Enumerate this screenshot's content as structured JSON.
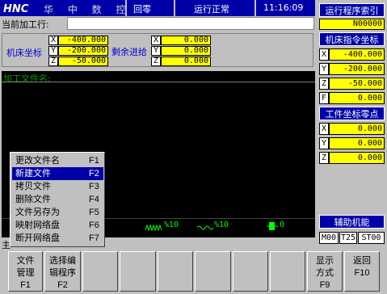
{
  "header": {
    "brand": "华 中 数 控",
    "mode": "回零",
    "state": "运行正常",
    "time": "11:16:09"
  },
  "current_job": {
    "label": "当前加工行:",
    "value": ""
  },
  "coords": {
    "label": "机床坐标",
    "remaining_label": "剩余进给",
    "machine": [
      {
        "axis": "X",
        "value": "-400.000"
      },
      {
        "axis": "Y",
        "value": "-200.000"
      },
      {
        "axis": "Z",
        "value": "-50.000"
      }
    ],
    "remaining": [
      {
        "axis": "X",
        "value": "0.000"
      },
      {
        "axis": "Y",
        "value": "0.000"
      },
      {
        "axis": "Z",
        "value": "0.000"
      }
    ]
  },
  "file_area": {
    "label": "加工文件名:"
  },
  "status_bar": {
    "feed": "%10",
    "spindle": "%10",
    "rapid": "0"
  },
  "popup_menu": [
    {
      "label": "更改文件名",
      "key": "F1"
    },
    {
      "label": "新建文件",
      "key": "F2"
    },
    {
      "label": "拷贝文件",
      "key": "F3"
    },
    {
      "label": "删除文件",
      "key": "F4"
    },
    {
      "label": "文件另存为",
      "key": "F5"
    },
    {
      "label": "映射网络盘",
      "key": "F6"
    },
    {
      "label": "断开网络盘",
      "key": "F7"
    }
  ],
  "main_label": "主",
  "right_panel": {
    "program_index_title": "运行程序索引",
    "program_index_value": "N00000",
    "cmd_title": "机床指令坐标",
    "cmd": [
      {
        "axis": "X",
        "value": "-400.000"
      },
      {
        "axis": "Y",
        "value": "-200.000"
      },
      {
        "axis": "Z",
        "value": "-50.000"
      },
      {
        "axis": "F",
        "value": "0.000"
      }
    ],
    "wcs_title": "工件坐标零点",
    "wcs": [
      {
        "axis": "X",
        "value": "0.000"
      },
      {
        "axis": "Y",
        "value": "0.000"
      },
      {
        "axis": "Z",
        "value": "0.000"
      }
    ],
    "aux_title": "辅助机能",
    "aux": [
      "M00",
      "T25",
      "ST00"
    ]
  },
  "fkeys": [
    {
      "line1": "文件",
      "line2": "管理",
      "key": "F1"
    },
    {
      "line1": "选择编",
      "line2": "辑程序",
      "key": "F2"
    },
    {
      "line1": "",
      "line2": "",
      "key": ""
    },
    {
      "line1": "",
      "line2": "",
      "key": ""
    },
    {
      "line1": "",
      "line2": "",
      "key": ""
    },
    {
      "line1": "",
      "line2": "",
      "key": ""
    },
    {
      "line1": "",
      "line2": "",
      "key": ""
    },
    {
      "line1": "",
      "line2": "",
      "key": ""
    },
    {
      "line1": "显示",
      "line2": "方式",
      "key": "F9"
    },
    {
      "line1": "返回",
      "line2": "",
      "key": "F10"
    }
  ],
  "colors": {
    "title_blue": "#0000a8",
    "value_yellow": "#ffff00",
    "panel_gray": "#c0c0c0"
  }
}
